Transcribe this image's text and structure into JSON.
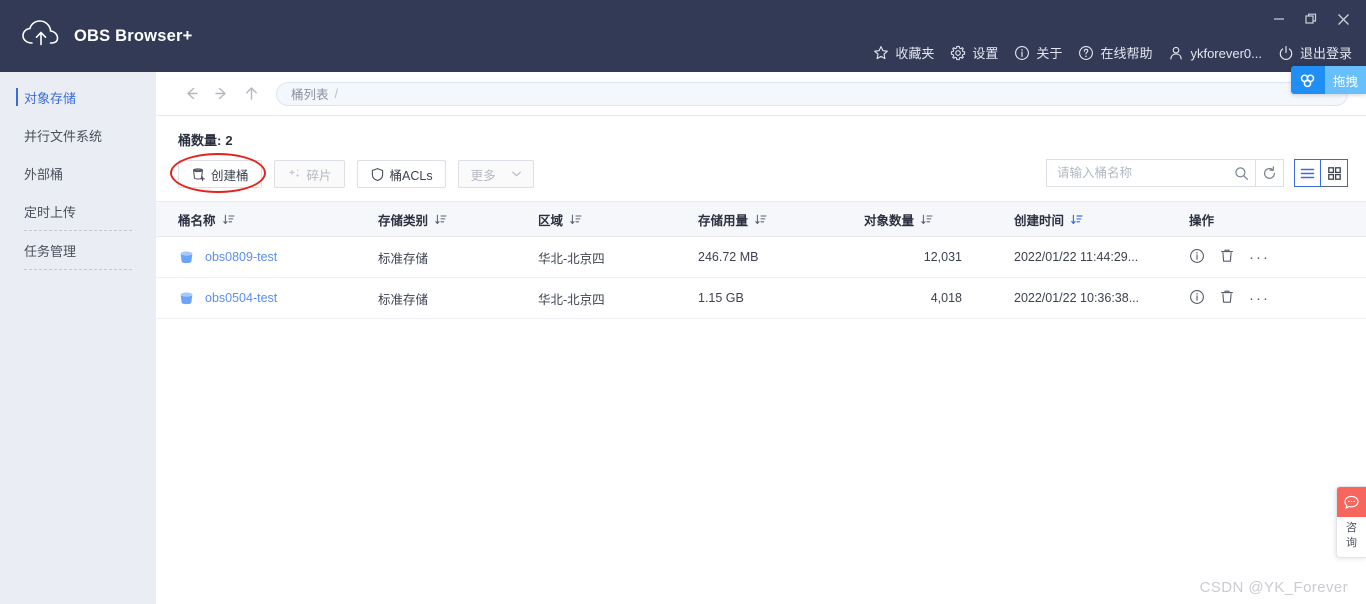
{
  "window": {
    "title": "OBS Browser+",
    "controls": [
      {
        "name": "minimize",
        "glyph": "minimize-icon"
      },
      {
        "name": "restore",
        "glyph": "restore-icon"
      },
      {
        "name": "close",
        "glyph": "close-icon"
      }
    ]
  },
  "header": {
    "items": [
      {
        "icon": "star-icon",
        "label": "收藏夹"
      },
      {
        "icon": "gear-icon",
        "label": "设置"
      },
      {
        "icon": "info-icon",
        "label": "关于"
      },
      {
        "icon": "question-icon",
        "label": "在线帮助"
      },
      {
        "icon": "user-icon",
        "label": "ykforever0..."
      },
      {
        "icon": "power-icon",
        "label": "退出登录"
      }
    ]
  },
  "sidebar": {
    "items": [
      {
        "label": "对象存储",
        "active": true,
        "separator_below": false
      },
      {
        "label": "并行文件系统",
        "active": false,
        "separator_below": false
      },
      {
        "label": "外部桶",
        "active": false,
        "separator_below": false
      },
      {
        "label": "定时上传",
        "active": false,
        "separator_below": true
      },
      {
        "label": "任务管理",
        "active": false,
        "separator_below": true
      }
    ],
    "collapse_icon": "collapse-left-icon"
  },
  "nav": {
    "back_icon": "arrow-left-icon",
    "forward_icon": "arrow-right-icon",
    "up_icon": "arrow-up-icon",
    "breadcrumb": "桶列表",
    "breadcrumb_sep": "/"
  },
  "main": {
    "count_label": "桶数量:",
    "count_value": "2",
    "toolbar": [
      {
        "icon": "bucket-add-icon",
        "label": "创建桶",
        "disabled": false,
        "caret": false,
        "highlighted": true
      },
      {
        "icon": "fragment-icon",
        "label": "碎片",
        "disabled": true,
        "caret": false,
        "highlighted": false
      },
      {
        "icon": "shield-icon",
        "label": "桶ACLs",
        "disabled": false,
        "caret": false,
        "highlighted": false
      },
      {
        "icon": "",
        "label": "更多",
        "disabled": true,
        "caret": true,
        "highlighted": false
      }
    ],
    "search": {
      "placeholder": "请输入桶名称",
      "value": "",
      "search_icon": "search-icon",
      "refresh_icon": "refresh-icon"
    },
    "view": {
      "list_icon": "list-view-icon",
      "grid_icon": "grid-view-icon",
      "active": "list"
    }
  },
  "table": {
    "columns": [
      {
        "label": "桶名称",
        "sortable": true,
        "sort_active": false
      },
      {
        "label": "存储类别",
        "sortable": true,
        "sort_active": false
      },
      {
        "label": "区域",
        "sortable": true,
        "sort_active": false
      },
      {
        "label": "存储用量",
        "sortable": true,
        "sort_active": false
      },
      {
        "label": "对象数量",
        "sortable": true,
        "sort_active": false
      },
      {
        "label": "创建时间",
        "sortable": true,
        "sort_active": true
      },
      {
        "label": "操作",
        "sortable": false,
        "sort_active": false
      }
    ],
    "rows": [
      {
        "name": "obs0809-test",
        "storage_class": "标准存储",
        "region": "华北-北京四",
        "usage": "246.72 MB",
        "objects": "12,031",
        "created": "2022/01/22 11:44:29...",
        "actions": [
          "info-icon",
          "trash-icon",
          "more-icon"
        ]
      },
      {
        "name": "obs0504-test",
        "storage_class": "标准存储",
        "region": "华北-北京四",
        "usage": "1.15 GB",
        "objects": "4,018",
        "created": "2022/01/22 10:36:38...",
        "actions": [
          "info-icon",
          "trash-icon",
          "more-icon"
        ]
      }
    ]
  },
  "widgets": {
    "drag": {
      "icon": "cloud-drag-icon",
      "label": "拖拽"
    },
    "consult": {
      "icon": "chat-bubble-icon",
      "label": "咨询"
    }
  },
  "watermark": "CSDN @YK_Forever",
  "colors": {
    "titlebar": "#333a56",
    "accent": "#3b6be0",
    "link": "#5b8ff0",
    "sidebar": "#eaeef4",
    "annotation": "#e3241c",
    "consult": "#f7665c",
    "drag": "#1f8ff5"
  }
}
